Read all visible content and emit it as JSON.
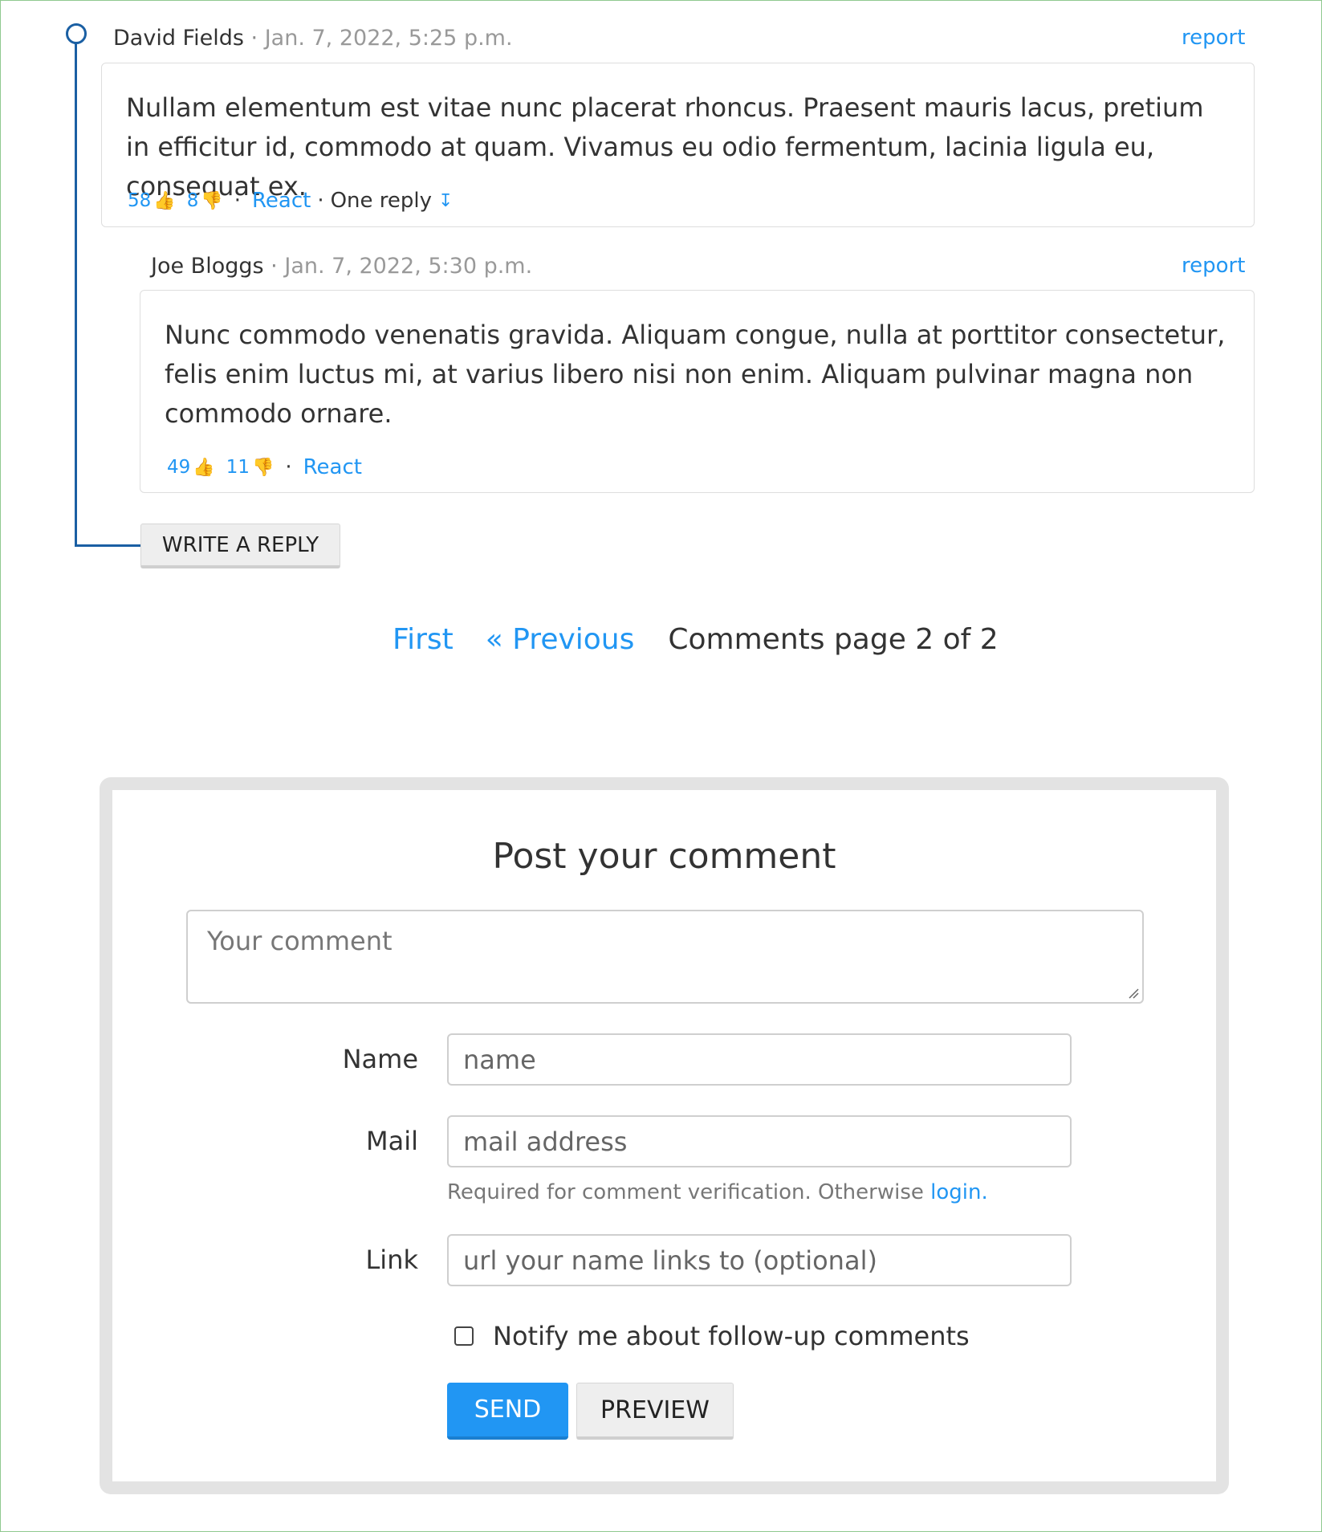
{
  "comments": [
    {
      "author": "David Fields",
      "separator": "·",
      "date": "Jan. 7, 2022, 5:25 p.m.",
      "report_label": "report",
      "body": "Nullam elementum est vitae nunc placerat rhoncus. Praesent mauris lacus, pretium in efficitur id, commodo at quam. Vivamus eu odio fermentum, lacinia ligula eu, consequat ex.",
      "likes": "58",
      "dislikes": "8",
      "react_label": "React",
      "replies_label": "One reply",
      "replies_icon": "↧"
    },
    {
      "author": "Joe Bloggs",
      "separator": "·",
      "date": "Jan. 7, 2022, 5:30 p.m.",
      "report_label": "report",
      "body": "Nunc commodo venenatis gravida. Aliquam congue, nulla at porttitor consectetur, felis enim luctus mi, at varius libero nisi non enim. Aliquam pulvinar magna non commodo ornare.",
      "likes": "49",
      "dislikes": "11",
      "react_label": "React"
    }
  ],
  "dot_separator": "·",
  "write_reply_label": "WRITE A REPLY",
  "pagination": {
    "first": "First",
    "previous": "« Previous",
    "status": "Comments page 2 of 2"
  },
  "form": {
    "title": "Post your comment",
    "comment_placeholder": "Your comment",
    "name_label": "Name",
    "name_placeholder": "name",
    "mail_label": "Mail",
    "mail_placeholder": "mail address",
    "mail_help": "Required for comment verification. Otherwise ",
    "login_link": "login.",
    "link_label": "Link",
    "link_placeholder": "url your name links to (optional)",
    "notify_label": "Notify me about follow-up comments",
    "send_label": "SEND",
    "preview_label": "PREVIEW"
  },
  "icons": {
    "thumbs_up": "👍",
    "thumbs_down": "👎"
  },
  "colors": {
    "link": "#2196f3",
    "thread_line": "#1a5fa3",
    "frame": "#8fc98f"
  }
}
